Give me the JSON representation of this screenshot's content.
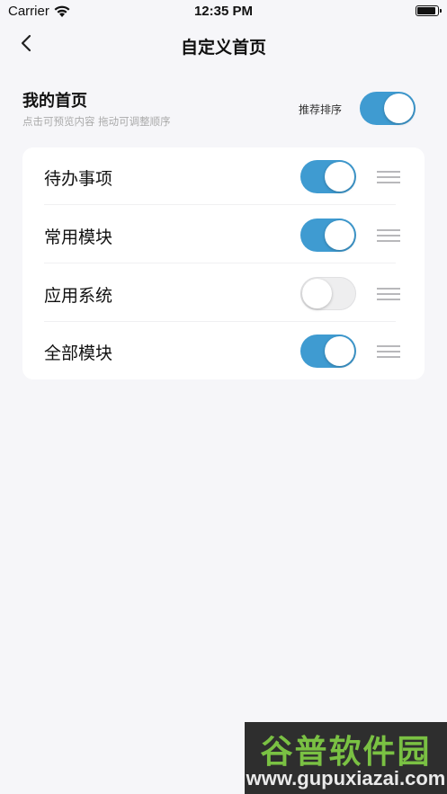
{
  "status_bar": {
    "carrier": "Carrier",
    "time": "12:35 PM"
  },
  "nav": {
    "title": "自定义首页"
  },
  "header": {
    "title": "我的首页",
    "subtitle": "点击可预览内容 拖动可调整顺序",
    "recommend_label": "推荐排序",
    "recommend_on": true
  },
  "modules": [
    {
      "label": "待办事项",
      "enabled": true
    },
    {
      "label": "常用模块",
      "enabled": true
    },
    {
      "label": "应用系统",
      "enabled": false
    },
    {
      "label": "全部模块",
      "enabled": true
    }
  ],
  "colors": {
    "accent": "#3f9bd1",
    "background": "#f6f6f9"
  },
  "watermark": {
    "title": "谷普软件园",
    "url": "www.gupuxiazai.com"
  }
}
